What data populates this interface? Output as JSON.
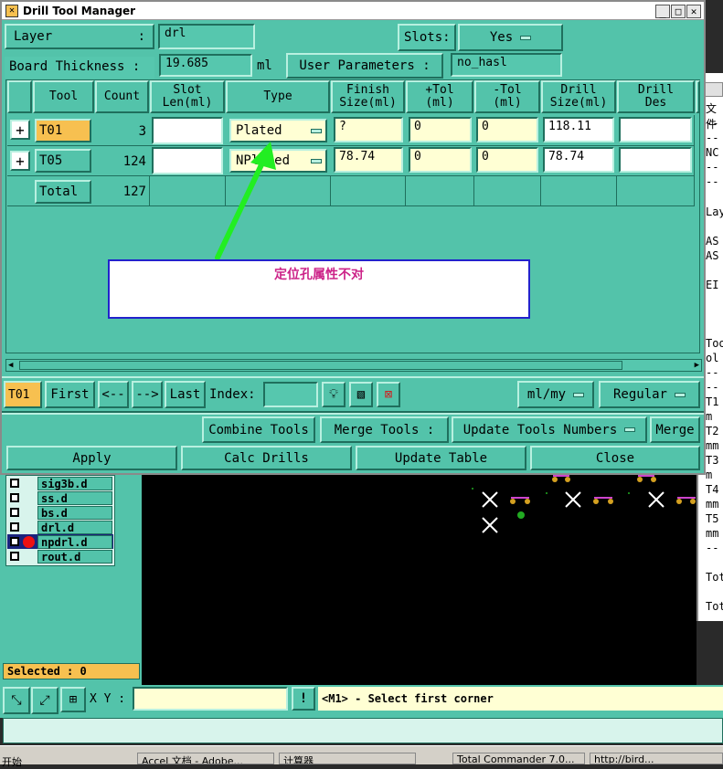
{
  "window": {
    "title": "Drill Tool Manager"
  },
  "layer": {
    "label": "Layer",
    "value": "drl"
  },
  "slots": {
    "label": "Slots:",
    "value": "Yes"
  },
  "board": {
    "label": "Board Thickness :",
    "value": "19.685",
    "unit": "ml"
  },
  "user_params": {
    "label": "User Parameters :",
    "value": "no_hasl"
  },
  "table": {
    "headers": [
      "Tool",
      "Count",
      "Slot\nLen(ml)",
      "Type",
      "Finish\nSize(ml)",
      "+Tol\n(ml)",
      "-Tol\n(ml)",
      "Drill\nSize(ml)",
      "Drill\nDes"
    ],
    "rows": [
      {
        "tool": "T01",
        "count": "3",
        "slot_len": "",
        "type": "Plated",
        "finish": "?",
        "ptol": "0",
        "ntol": "0",
        "drill_size": "118.11",
        "drill_des": ""
      },
      {
        "tool": "T05",
        "count": "124",
        "slot_len": "",
        "type": "NPlated",
        "finish": "78.74",
        "ptol": "0",
        "ntol": "0",
        "drill_size": "78.74",
        "drill_des": ""
      }
    ],
    "total_label": "Total",
    "total_count": "127"
  },
  "annotation": {
    "text": "定位孔属性不对"
  },
  "nav": {
    "current": "T01",
    "first": "First",
    "prev": "<--",
    "next": "-->",
    "last": "Last",
    "index_label": "Index:",
    "units": "ml/my",
    "mode": "Regular"
  },
  "actions": {
    "combine": "Combine Tools",
    "merge_tools": "Merge Tools :",
    "update_numbers": "Update Tools Numbers",
    "merge": "Merge",
    "apply": "Apply",
    "calc": "Calc Drills",
    "update_table": "Update Table",
    "close": "Close"
  },
  "layers": [
    "sig3b.d",
    "ss.d",
    "bs.d",
    "drl.d",
    "npdrl.d",
    "rout.d"
  ],
  "selected": "Selected : 0",
  "status": {
    "xy_label": "X Y :",
    "message": "<M1> - Select first corner"
  },
  "right_panel": {
    "lines": [
      "文件",
      "--",
      "--",
      "NC",
      "--",
      "--",
      "Lay",
      "AS",
      "AS",
      "EI",
      "Too",
      "ol",
      "--",
      "--",
      "T1",
      "m",
      "T2",
      "mm",
      "T3",
      "m",
      "T4",
      "mm",
      "T5",
      "mm",
      "--",
      "Tot",
      "Tot"
    ]
  },
  "taskbar": {
    "items": [
      "开始",
      "Accel 文档 - Adobe...",
      "计算器",
      "Total Commander 7.0...",
      "http://bird..."
    ]
  },
  "colors": {
    "panel": "#53c3aa",
    "tool_button": "#f7c050",
    "input_yellow": "#ffffd4",
    "annotation_text": "#cc2288",
    "arrow": "#22ee22"
  }
}
